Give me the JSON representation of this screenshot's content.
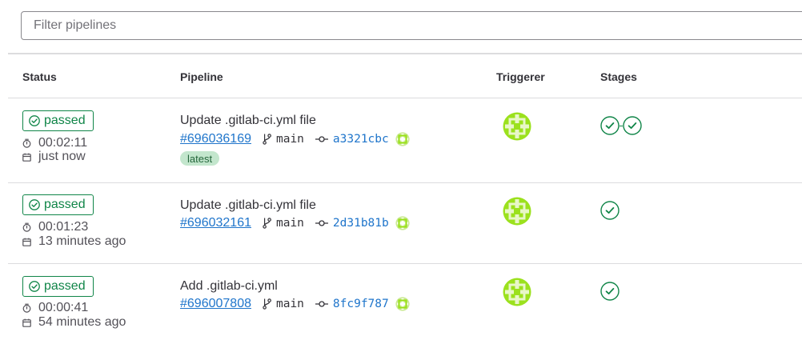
{
  "filter": {
    "placeholder": "Filter pipelines"
  },
  "table": {
    "headers": {
      "status": "Status",
      "pipeline": "Pipeline",
      "triggerer": "Triggerer",
      "stages": "Stages"
    }
  },
  "pipelines": [
    {
      "status": "passed",
      "duration": "00:02:11",
      "finished": "just now",
      "title": "Update .gitlab-ci.yml file",
      "id": "#696036169",
      "branch": "main",
      "sha": "a3321cbc",
      "latest_label": "latest",
      "stage_count": 2
    },
    {
      "status": "passed",
      "duration": "00:01:23",
      "finished": "13 minutes ago",
      "title": "Update .gitlab-ci.yml file",
      "id": "#696032161",
      "branch": "main",
      "sha": "2d31b81b",
      "stage_count": 1
    },
    {
      "status": "passed",
      "duration": "00:00:41",
      "finished": "54 minutes ago",
      "title": "Add .gitlab-ci.yml",
      "id": "#696007808",
      "branch": "main",
      "sha": "8fc9f787",
      "stage_count": 1
    }
  ],
  "colors": {
    "success": "#108548",
    "link": "#1f75cb",
    "avatar": "#9be11d",
    "latest_bg": "#c3e6cd"
  },
  "icons": {
    "status": "status-success-icon",
    "duration": "timer-icon",
    "finished": "calendar-icon",
    "branch": "branch-icon",
    "commit": "commit-icon",
    "triggerer": "identicon-avatar"
  }
}
